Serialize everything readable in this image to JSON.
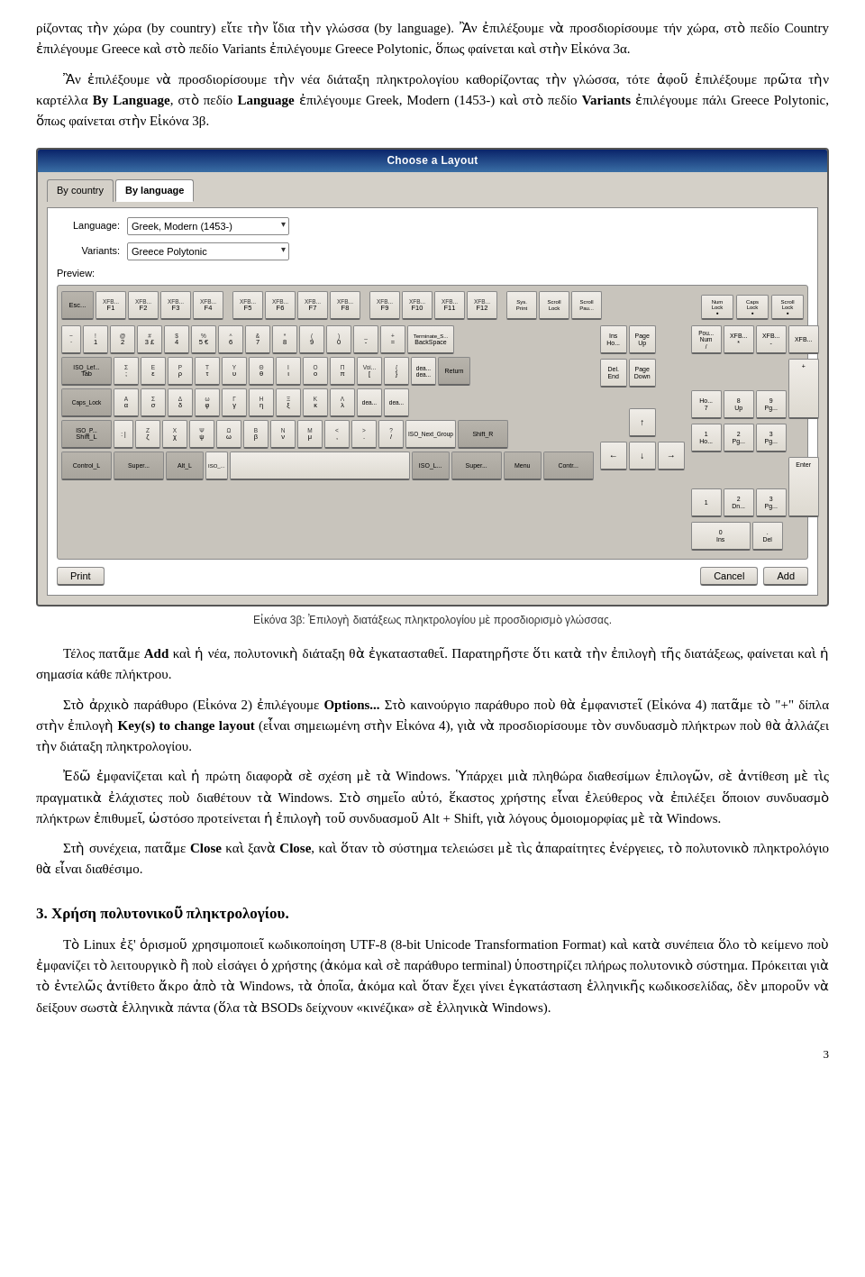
{
  "paragraph1": "ρίζοντας τὴν χώρα (by country) εἴτε τὴν ἴδια τὴν γλώσσα (by language). Ἂν ἐπιλέξουμε νὰ προσδιορίσουμε τήν χώρα, στὸ πεδίο Country ἐπιλέγουμε Greece καὶ στὸ πεδίο Variants ἐπιλέγουμε Greece Polytonic, ὅπως φαίνεται καὶ στὴν Εἰκόνα 3α.",
  "paragraph2": "Ἂν ἐπιλέξουμε νὰ προσδιορίσουμε τὴν νέα διάταξη πληκτρολογίου καθορίζοντας τὴν γλώσσα, τότε ἀφοῦ ἐπιλέξουμε πρῶτα τὴν καρτέλλα By Language, στὸ πεδίο Language ἐπιλέγουμε Greek, Modern (1453-) καὶ στὸ πεδίο Variants ἐπιλέγουμε πάλι Greece Polytonic, ὅπως φαίνεται στὴν Εἰκόνα 3β.",
  "dialog": {
    "title": "Choose a Layout",
    "tab_country": "By country",
    "tab_language": "By language",
    "label_language": "Language:",
    "label_variants": "Variants:",
    "language_value": "Greek, Modern (1453-)",
    "variants_value": "Greece Polytonic",
    "preview_label": "Preview:",
    "btn_print": "Print",
    "btn_cancel": "Cancel",
    "btn_add": "Add"
  },
  "figure_caption": "Εἰκόνα 3β: Ἐπιλογὴ διατάξεως πληκτρολογίου μὲ προσδιορισμὸ γλώσσας.",
  "paragraph3": "Τέλος πατᾶμε Add καὶ ἡ νέα, πολυτονικὴ διάταξη θὰ ἐγκατασταθεῖ. Παρατηρῆστε ὅτι κατὰ τὴν ἐπιλογὴ τῆς διατάξεως, φαίνεται καὶ ἡ σημασία κάθε πλήκτρου.",
  "paragraph4": "Στὸ ἀρχικὸ παράθυρο (Εἰκόνα 2) ἐπιλέγουμε Options... Στὸ καινούργιο παράθυρο ποὺ θὰ ἐμφανιστεῖ (Εἰκόνα 4) πατᾶμε τὸ \"+\" δίπλα στὴν ἐπιλογὴ Key(s) to change layout (εἶναι σημειωμένη στὴν Εἰκόνα 4), γιὰ νὰ προσδιορίσουμε τὸν συνδυασμὸ πλήκτρων ποὺ θὰ ἀλλάζει τὴν διάταξη πληκτρολογίου.",
  "paragraph5": "Ἐδῶ ἐμφανίζεται καὶ ἡ πρώτη διαφορὰ σὲ σχέση μὲ τὰ Windows. Ὑπάρχει μιὰ πληθώρα διαθεσίμων ἐπιλογῶν, σὲ ἀντίθεση μὲ τὶς πραγματικὰ ἐλάχιστες ποὺ διαθέτουν τὰ Windows. Στὸ σημεῖο αὐτό, ἕκαστος χρήστης εἶναι ἐλεύθερος νὰ ἐπιλέξει ὅποιον συνδυασμὸ πλήκτρων ἐπιθυμεῖ, ὡστόσο προτείνεται ἡ ἐπιλογὴ τοῦ συνδυασμοῦ Alt + Shift, γιὰ λόγους ὁμοιομορφίας μὲ τὰ Windows.",
  "paragraph6": "Στὴ συνέχεια, πατᾶμε Close καὶ ξανὰ Close, καὶ ὅταν τὸ σύστημα τελειώσει μὲ τὶς ἀπαραίτητες ἐνέργειες, τὸ πολυτονικὸ πληκτρολόγιο θὰ εἶναι διαθέσιμο.",
  "section3_heading": "3.  Χρήση πολυτονικοῦ πληκτρολογίου.",
  "paragraph7": "Τὸ Linux ἐξ' ὁρισμοῦ χρησιμοποιεῖ κωδικοποίηση UTF-8 (8-bit Unicode Transformation Format) καὶ κατὰ συνέπεια ὅλο τὸ κείμενο ποὺ ἐμφανίζει τὸ λειτουργικὸ ἢ ποὺ εἰσάγει ὁ χρήστης (ἀκόμα καὶ σὲ παράθυρο terminal) ὑποστηρίζει πλήρως πολυτονικὸ σύστημα. Πρόκειται γιὰ τὸ ἐντελῶς ἀντίθετο ἄκρο ἀπὸ τὰ Windows, τὰ ὁποῖα, ἀκόμα καὶ ὅταν ἔχει γίνει ἐγκατάσταση ἑλληνικῆς κωδικοσελίδας, δὲν μποροῦν νὰ δείξουν σωστὰ ἑλληνικὰ πάντα (ὅλα τὰ BSODs δείχνουν «κινέζικα» σὲ ἑλληνικὰ Windows).",
  "page_number": "3"
}
